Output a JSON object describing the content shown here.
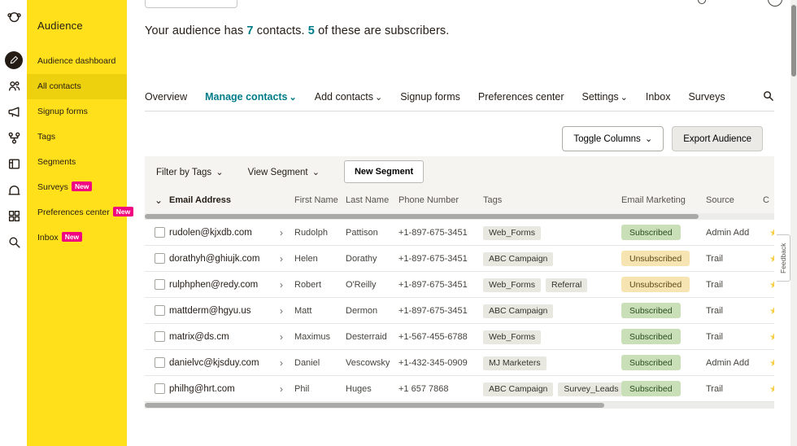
{
  "colors": {
    "accent_yellow": "#FFE01B",
    "active_item_yellow": "#EDD00E",
    "teal": "#007C89",
    "badge_pink": "#F0047F",
    "text_dark": "#241C15",
    "text_gray": "#56534C",
    "tag_bg": "#E9E8E0",
    "subscribed_bg": "#C9DFB8",
    "subscribed_text": "#2c4a20",
    "unsubscribed_bg": "#F6E5B3",
    "unsubscribed_text": "#5c4a16",
    "star_yellow": "#F5CE42"
  },
  "icons": {
    "caret_down": "⌄",
    "chevron_right": "›",
    "star": "★"
  },
  "icon_rail": {
    "items": [
      "mailchimp-logo",
      "create",
      "audience",
      "campaigns",
      "automations",
      "reports",
      "content-studio",
      "integrations",
      "search"
    ]
  },
  "sidebar": {
    "title": "Audience",
    "items": [
      {
        "label": "Audience dashboard",
        "badge": ""
      },
      {
        "label": "All contacts",
        "badge": ""
      },
      {
        "label": "Signup forms",
        "badge": ""
      },
      {
        "label": "Tags",
        "badge": ""
      },
      {
        "label": "Segments",
        "badge": ""
      },
      {
        "label": "Surveys",
        "badge": "New"
      },
      {
        "label": "Preferences center",
        "badge": "New"
      },
      {
        "label": "Inbox",
        "badge": "New"
      }
    ]
  },
  "header": {
    "summary_prefix": "Your audience has ",
    "contacts_count": "7",
    "summary_mid": " contacts. ",
    "subscribers_count": "5",
    "summary_suffix": " of these are subscribers."
  },
  "nav": {
    "tabs": [
      {
        "label": "Overview"
      },
      {
        "label": "Manage contacts"
      },
      {
        "label": "Add contacts"
      },
      {
        "label": "Signup forms"
      },
      {
        "label": "Preferences center"
      },
      {
        "label": "Settings"
      },
      {
        "label": "Inbox"
      },
      {
        "label": "Surveys"
      }
    ]
  },
  "actions": {
    "toggle_columns": "Toggle Columns",
    "export_audience": "Export Audience"
  },
  "toolbar": {
    "filter_by_tags": "Filter by Tags",
    "view_segment": "View Segment",
    "new_segment": "New Segment"
  },
  "table": {
    "columns": {
      "email": "Email Address",
      "first": "First Name",
      "last": "Last Name",
      "phone": "Phone Number",
      "tags": "Tags",
      "marketing": "Email Marketing",
      "source": "Source",
      "cut": "C"
    },
    "rows": [
      {
        "email": "rudolen@kjxdb.com",
        "first": "Rudolph",
        "last": "Pattison",
        "phone": "+1-897-675-3451",
        "tags": [
          "Web_Forms"
        ],
        "status": "Subscribed",
        "source": "Admin Add"
      },
      {
        "email": "dorathyh@ghiujk.com",
        "first": "Helen",
        "last": "Dorathy",
        "phone": "+1-897-675-3451",
        "tags": [
          "ABC Campaign"
        ],
        "status": "Unsubscribed",
        "source": "Trail"
      },
      {
        "email": "rulphphen@redy.com",
        "first": "Robert",
        "last": "O'Reilly",
        "phone": "+1-897-675-3451",
        "tags": [
          "Web_Forms",
          "Referral"
        ],
        "status": "Unsubscribed",
        "source": "Trail"
      },
      {
        "email": "mattderm@hgyu.us",
        "first": "Matt",
        "last": "Dermon",
        "phone": "+1-897-675-3451",
        "tags": [
          "ABC Campaign"
        ],
        "status": "Subscribed",
        "source": "Trail"
      },
      {
        "email": "matrix@ds.cm",
        "first": "Maximus",
        "last": "Desterraid",
        "phone": "+1-567-455-6788",
        "tags": [
          "Web_Forms"
        ],
        "status": "Subscribed",
        "source": "Trail"
      },
      {
        "email": "danielvc@kjsduy.com",
        "first": "Daniel",
        "last": "Vescowsky",
        "phone": "+1-432-345-0909",
        "tags": [
          "MJ Marketers"
        ],
        "status": "Subscribed",
        "source": "Admin Add"
      },
      {
        "email": "philhg@hrt.com",
        "first": "Phil",
        "last": "Huges",
        "phone": "+1 657 7868",
        "tags": [
          "ABC Campaign",
          "Survey_Leads"
        ],
        "status": "Subscribed",
        "source": "Trail"
      }
    ]
  },
  "feedback": {
    "label": "Feedback"
  }
}
